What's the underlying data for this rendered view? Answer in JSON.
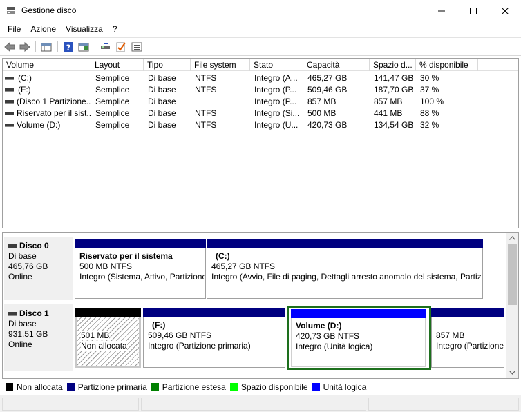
{
  "window": {
    "title": "Gestione disco"
  },
  "menu": [
    "File",
    "Azione",
    "Visualizza",
    "?"
  ],
  "list": {
    "columns": [
      "Volume",
      "Layout",
      "Tipo",
      "File system",
      "Stato",
      "Capacità",
      "Spazio d...",
      "% disponibile"
    ],
    "rows": [
      [
        "(C:)",
        "Semplice",
        "Di base",
        "NTFS",
        "Integro (A...",
        "465,27 GB",
        "141,47 GB",
        "30 %"
      ],
      [
        "(F:)",
        "Semplice",
        "Di base",
        "NTFS",
        "Integro (P...",
        "509,46 GB",
        "187,70 GB",
        "37 %"
      ],
      [
        "(Disco 1 Partizione...",
        "Semplice",
        "Di base",
        "",
        "Integro (P...",
        "857 MB",
        "857 MB",
        "100 %"
      ],
      [
        "Riservato per il sist...",
        "Semplice",
        "Di base",
        "NTFS",
        "Integro (Si...",
        "500 MB",
        "441 MB",
        "88 %"
      ],
      [
        "Volume (D:)",
        "Semplice",
        "Di base",
        "NTFS",
        "Integro (U...",
        "420,73 GB",
        "134,54 GB",
        "32 %"
      ]
    ]
  },
  "disks": [
    {
      "name": "Disco 0",
      "type": "Di base",
      "size": "465,76 GB",
      "status": "Online",
      "partitions": [
        {
          "name": "Riservato per il sistema",
          "size": "500 MB NTFS",
          "status": "Integro (Sistema, Attivo, Partizione primaria)",
          "color": "#000080"
        },
        {
          "name": "(C:)",
          "size": "465,27 GB NTFS",
          "status": "Integro (Avvio, File di paging, Dettagli arresto anomalo del sistema, Partizione primaria)",
          "color": "#000080"
        }
      ]
    },
    {
      "name": "Disco 1",
      "type": "Di base",
      "size": "931,51 GB",
      "status": "Online",
      "partitions": [
        {
          "name": "",
          "size": "501 MB",
          "status": "Non allocata",
          "color": "#000000"
        },
        {
          "name": "(F:)",
          "size": "509,46 GB NTFS",
          "status": "Integro (Partizione primaria)",
          "color": "#000080"
        },
        {
          "name": "Volume  (D:)",
          "size": "420,73 GB NTFS",
          "status": "Integro (Unità logica)",
          "color": "#0000ff"
        },
        {
          "name": "",
          "size": "857 MB",
          "status": "Integro (Partizione primaria)",
          "color": "#000080"
        }
      ]
    }
  ],
  "legend": [
    {
      "label": "Non allocata",
      "color": "#000000"
    },
    {
      "label": "Partizione primaria",
      "color": "#000080"
    },
    {
      "label": "Partizione estesa",
      "color": "#008000"
    },
    {
      "label": "Spazio disponibile",
      "color": "#00ff00"
    },
    {
      "label": "Unità logica",
      "color": "#0000ff"
    }
  ],
  "colors": {
    "selection_frame": "#1d6f1d"
  }
}
